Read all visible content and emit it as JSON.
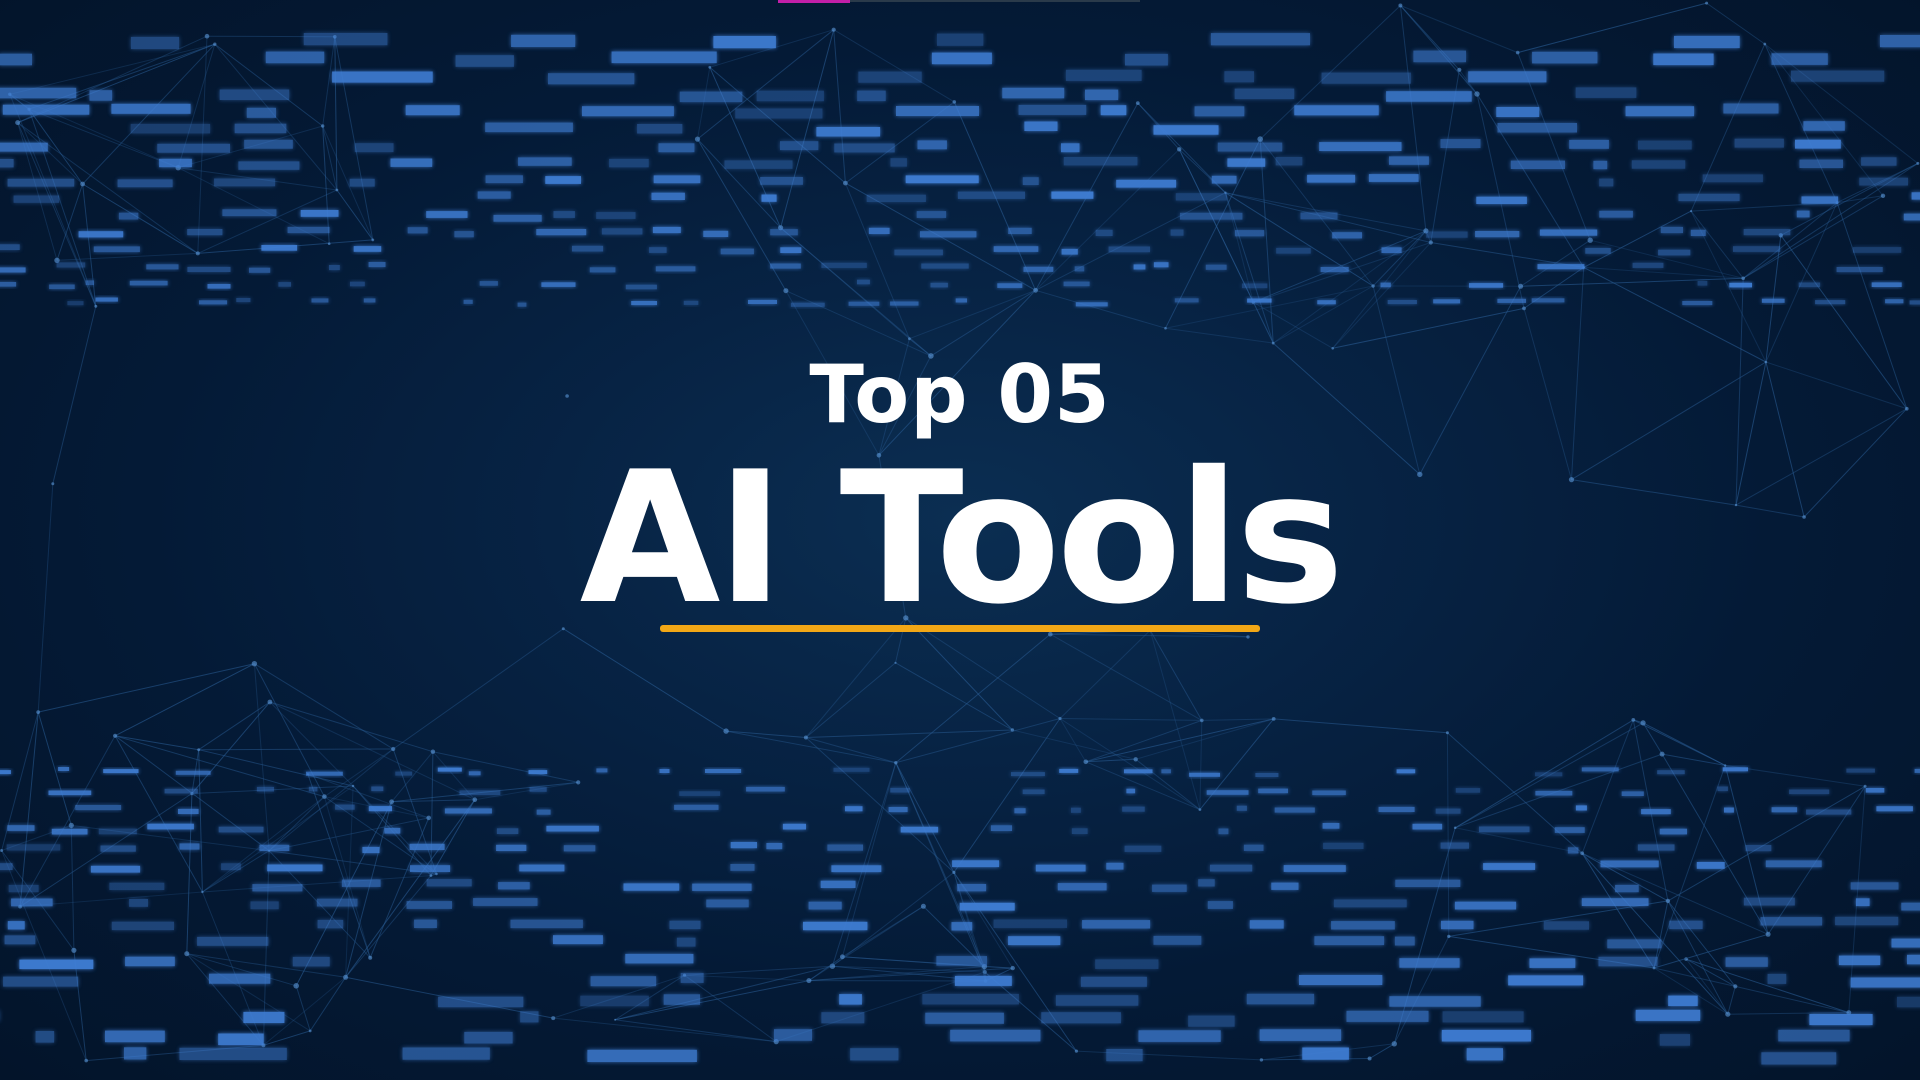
{
  "title": {
    "line1": "Top 05",
    "line2": "AI Tools"
  },
  "colors": {
    "background": "#061a33",
    "title_text": "#ffffff",
    "underline_accent": "#f2a716",
    "data_blocks": "#3f7fd6",
    "network_lines": "#2a5d95",
    "top_accent": "#c21fa8"
  },
  "icons": [
    "network-mesh-graphic",
    "digital-data-blocks-graphic"
  ]
}
